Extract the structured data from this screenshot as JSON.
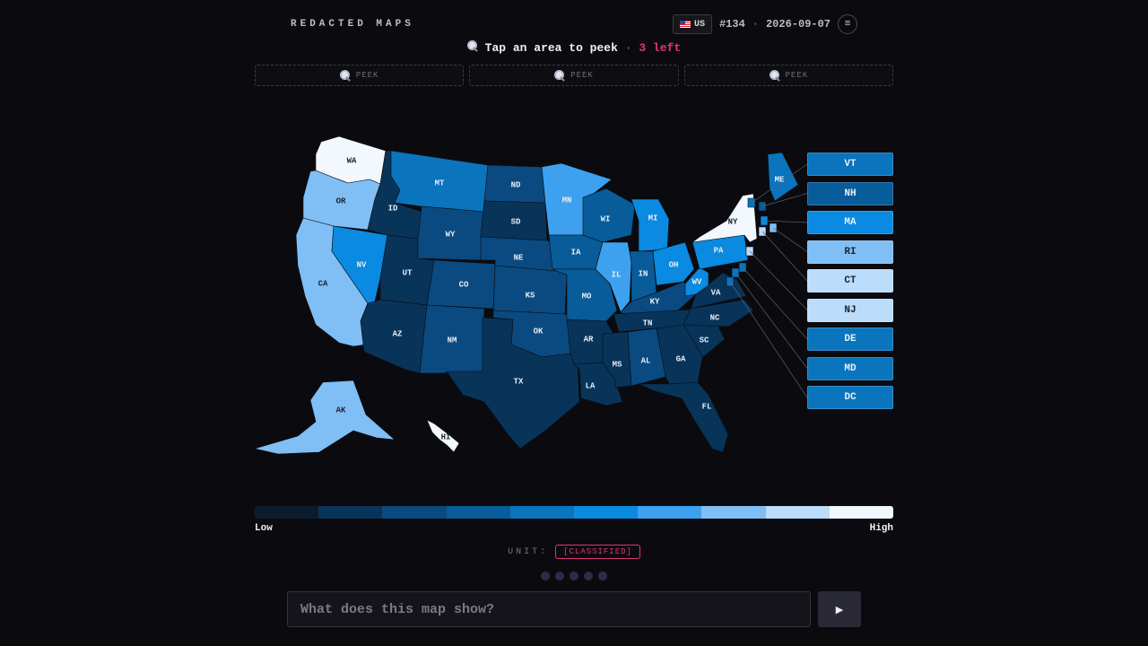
{
  "header": {
    "brand": "REDACTED MAPS",
    "region": "US",
    "puzzle_number": "#134",
    "separator": "·",
    "date": "2026-09-07",
    "menu_icon": "hamburger-icon"
  },
  "prompt": {
    "text": "Tap an area to peek",
    "separator": "·",
    "remaining": "3 left"
  },
  "peek_slots": [
    "PEEK",
    "PEEK",
    "PEEK"
  ],
  "legend": {
    "low_label": "Low",
    "high_label": "High",
    "colors": [
      "#0d1b2e",
      "#08345a",
      "#0a4a80",
      "#075c99",
      "#0a74bc",
      "#0a8ae0",
      "#3ea1f0",
      "#80bff5",
      "#bcdcfb",
      "#f3f8ff"
    ]
  },
  "unit": {
    "label": "UNIT:",
    "value": "[CLASSIFIED]"
  },
  "guesses": {
    "total": 5,
    "used": 0
  },
  "answer": {
    "placeholder": "What does this map show?",
    "submit_label": "▶"
  },
  "colors": {
    "accent": "#e0356f",
    "background": "#0b0b0f"
  },
  "states": [
    {
      "id": "WA",
      "shade": 9
    },
    {
      "id": "OR",
      "shade": 7
    },
    {
      "id": "CA",
      "shade": 7
    },
    {
      "id": "ID",
      "shade": 1
    },
    {
      "id": "NV",
      "shade": 5
    },
    {
      "id": "UT",
      "shade": 1
    },
    {
      "id": "AZ",
      "shade": 1
    },
    {
      "id": "MT",
      "shade": 4
    },
    {
      "id": "WY",
      "shade": 2
    },
    {
      "id": "CO",
      "shade": 2
    },
    {
      "id": "NM",
      "shade": 2
    },
    {
      "id": "ND",
      "shade": 2
    },
    {
      "id": "SD",
      "shade": 1
    },
    {
      "id": "NE",
      "shade": 2
    },
    {
      "id": "KS",
      "shade": 2
    },
    {
      "id": "OK",
      "shade": 2
    },
    {
      "id": "TX",
      "shade": 1
    },
    {
      "id": "MN",
      "shade": 6
    },
    {
      "id": "IA",
      "shade": 3
    },
    {
      "id": "MO",
      "shade": 3
    },
    {
      "id": "AR",
      "shade": 1
    },
    {
      "id": "LA",
      "shade": 1
    },
    {
      "id": "WI",
      "shade": 3
    },
    {
      "id": "IL",
      "shade": 6
    },
    {
      "id": "MI",
      "shade": 5
    },
    {
      "id": "IN",
      "shade": 3
    },
    {
      "id": "OH",
      "shade": 5
    },
    {
      "id": "KY",
      "shade": 2
    },
    {
      "id": "TN",
      "shade": 1
    },
    {
      "id": "MS",
      "shade": 1
    },
    {
      "id": "AL",
      "shade": 2
    },
    {
      "id": "GA",
      "shade": 1
    },
    {
      "id": "FL",
      "shade": 1
    },
    {
      "id": "SC",
      "shade": 1
    },
    {
      "id": "NC",
      "shade": 1
    },
    {
      "id": "VA",
      "shade": 1
    },
    {
      "id": "WV",
      "shade": 5
    },
    {
      "id": "PA",
      "shade": 5
    },
    {
      "id": "NY",
      "shade": 9
    },
    {
      "id": "ME",
      "shade": 4
    },
    {
      "id": "AK",
      "shade": 7
    },
    {
      "id": "HI",
      "shade": 9
    }
  ],
  "callouts": [
    {
      "id": "VT",
      "shade": 4
    },
    {
      "id": "NH",
      "shade": 3
    },
    {
      "id": "MA",
      "shade": 5
    },
    {
      "id": "RI",
      "shade": 7
    },
    {
      "id": "CT",
      "shade": 8
    },
    {
      "id": "NJ",
      "shade": 8
    },
    {
      "id": "DE",
      "shade": 4
    },
    {
      "id": "MD",
      "shade": 4
    },
    {
      "id": "DC",
      "shade": 4
    }
  ]
}
